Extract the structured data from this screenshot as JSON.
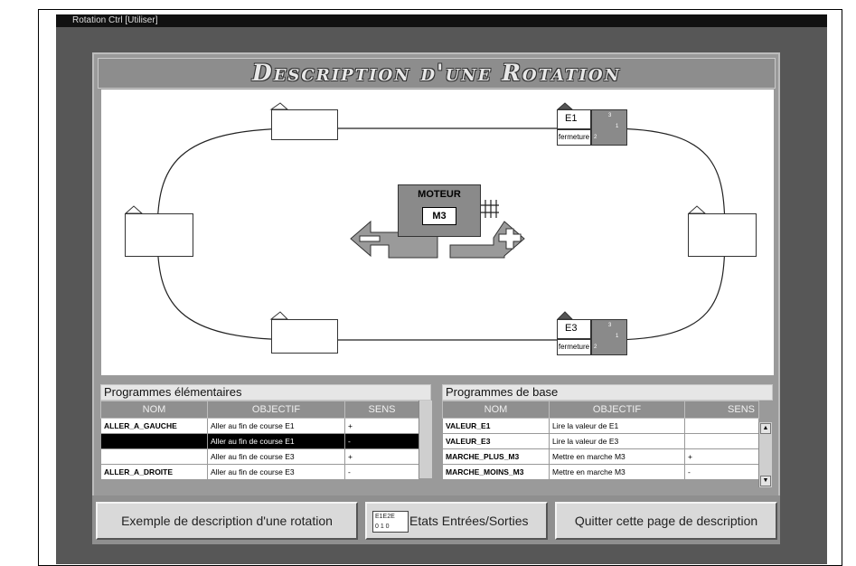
{
  "window": {
    "title": "Rotation Ctrl [Utiliser]"
  },
  "page": {
    "title": "Description d'une Rotation"
  },
  "motor": {
    "label": "MOTEUR",
    "name": "M3"
  },
  "switches": [
    {
      "name": "E1",
      "state": "fermeture",
      "pins": [
        "3",
        "1",
        "2"
      ]
    },
    {
      "name": "E3",
      "state": "fermeture",
      "pins": [
        "3",
        "1",
        "2"
      ]
    }
  ],
  "elementary": {
    "header": "Programmes élémentaires",
    "columns": [
      "NOM",
      "OBJECTIF",
      "SENS"
    ],
    "rows": [
      {
        "nom": "ALLER_A_GAUCHE",
        "objectif": "Aller au fin de course E1",
        "sens": "+"
      },
      {
        "nom": "",
        "objectif": "Aller au fin de course E1",
        "sens": "-"
      },
      {
        "nom": "",
        "objectif": "Aller au fin de course E3",
        "sens": "+"
      },
      {
        "nom": "ALLER_A_DROITE",
        "objectif": "Aller au fin de course E3",
        "sens": "-"
      }
    ]
  },
  "base": {
    "header": "Programmes de base",
    "columns": [
      "NOM",
      "OBJECTIF",
      "SENS"
    ],
    "rows": [
      {
        "nom": "VALEUR_E1",
        "objectif": "Lire la valeur de E1",
        "sens": ""
      },
      {
        "nom": "VALEUR_E3",
        "objectif": "Lire la valeur de E3",
        "sens": ""
      },
      {
        "nom": "MARCHE_PLUS_M3",
        "objectif": "Mettre en marche M3",
        "sens": "+"
      },
      {
        "nom": "MARCHE_MOINS_M3",
        "objectif": "Mettre en marche M3",
        "sens": "-"
      }
    ]
  },
  "buttons": {
    "example": "Exemple de description d'une rotation",
    "io": "Etats Entrées/Sorties",
    "io_icon_top": "E1E2E",
    "io_icon_bottom": "0 1 0",
    "quit": "Quitter cette page de description"
  }
}
